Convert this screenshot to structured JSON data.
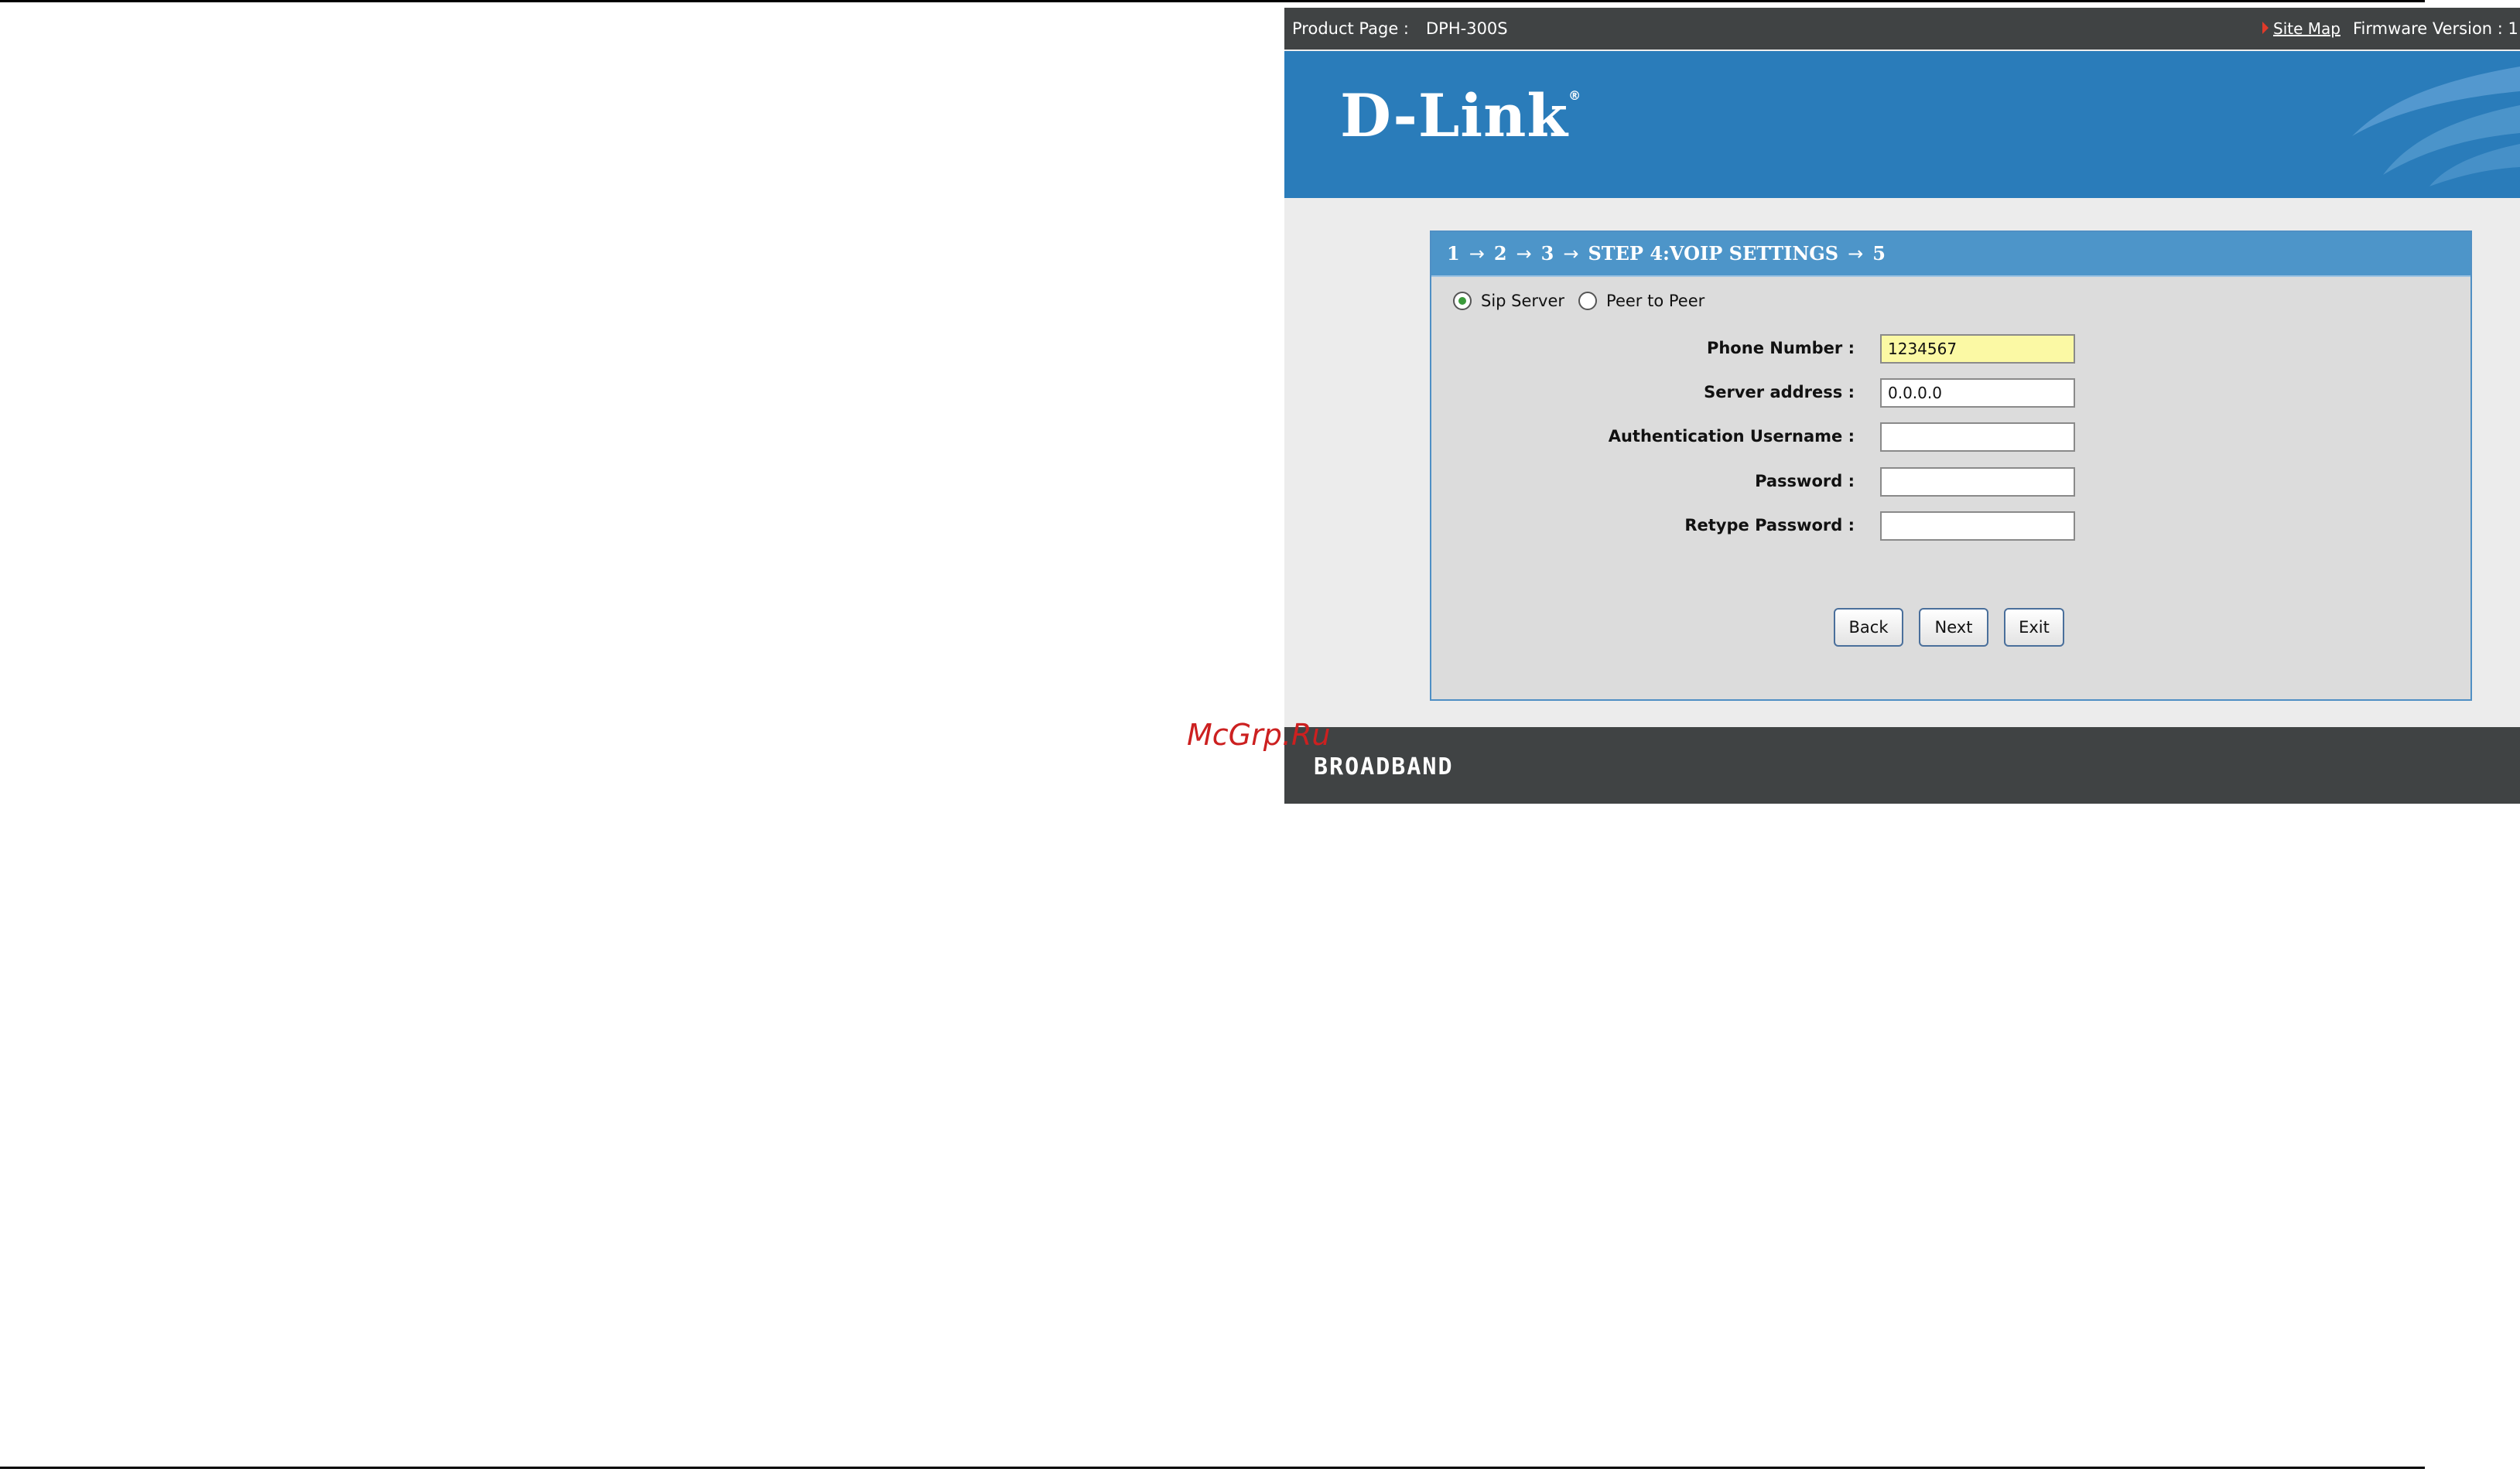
{
  "topbar": {
    "product_label": "Product Page :",
    "product_model": "DPH-300S",
    "site_map": "Site Map",
    "firmware_label": "Firmware Version : 1"
  },
  "banner": {
    "logo_text": "D-Link",
    "logo_mark": "®"
  },
  "wizard": {
    "steps_prefix": [
      "1",
      "2",
      "3"
    ],
    "current_step": "STEP 4:VOIP SETTINGS",
    "next_step": "5",
    "arrow": "→",
    "mode": {
      "options": [
        "Sip Server",
        "Peer to Peer"
      ],
      "selected": "Sip Server"
    },
    "fields": {
      "phone_number": {
        "label": "Phone Number :",
        "value": "1234567"
      },
      "server_address": {
        "label": "Server address :",
        "value": "0.0.0.0"
      },
      "auth_username": {
        "label": "Authentication Username :",
        "value": ""
      },
      "password": {
        "label": "Password :",
        "value": ""
      },
      "retype_password": {
        "label": "Retype Password :",
        "value": ""
      }
    },
    "buttons": {
      "back": "Back",
      "next": "Next",
      "exit": "Exit"
    }
  },
  "footer": {
    "brand": "BROADBAND"
  },
  "watermark": "McGrp.Ru",
  "colors": {
    "topbar": "#404344",
    "banner": "#2a7cba",
    "wizard_header": "#4d95c9",
    "highlight_input": "#fbf9a4"
  }
}
